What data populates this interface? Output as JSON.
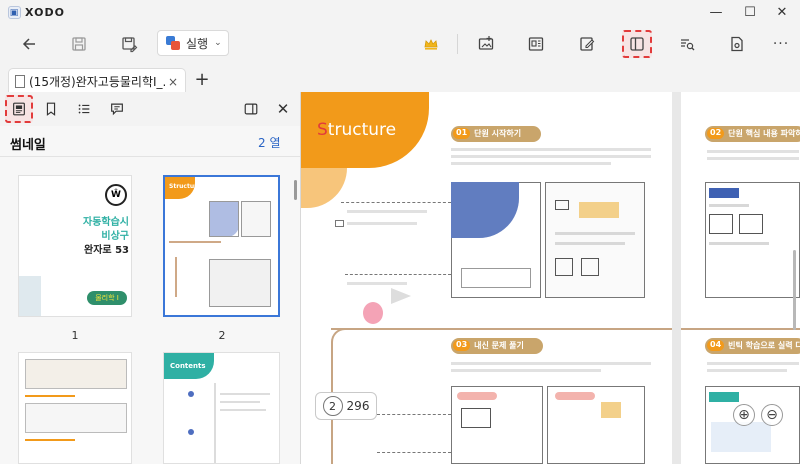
{
  "app": {
    "name": "XODO"
  },
  "window": {
    "minimize": "—",
    "maximize": "☐",
    "close": "✕"
  },
  "toolbar": {
    "execute_label": "실행",
    "more": "···"
  },
  "tabs": [
    {
      "title": "(15개정)완자고등물리학Ⅰ_...",
      "close": "×"
    }
  ],
  "new_tab": "+",
  "sidebar": {
    "title": "썸네일",
    "columns": "2 열",
    "close": "✕",
    "thumbnails": [
      {
        "page": "1",
        "lines": [
          "자동학습시",
          "비상구",
          "완자로 53"
        ],
        "badge": "물리학 Ⅰ"
      },
      {
        "page": "2",
        "heading": "Structure"
      },
      {
        "page": ""
      },
      {
        "page": "",
        "heading": "Contents"
      }
    ]
  },
  "document": {
    "heading": "Structure",
    "sections": [
      {
        "num": "01",
        "title": "단원 시작하기"
      },
      {
        "num": "02",
        "title": "단원 핵심 내용 파악하"
      },
      {
        "num": "03",
        "title": "내신 문제 풀기"
      },
      {
        "num": "04",
        "title": "빈틱 학습으로 실력 다"
      }
    ],
    "current_page": "2",
    "total_pages": "296"
  },
  "colors": {
    "accent": "#3b77d8",
    "orange": "#f29a1a",
    "highlight": "#e23b3b"
  }
}
